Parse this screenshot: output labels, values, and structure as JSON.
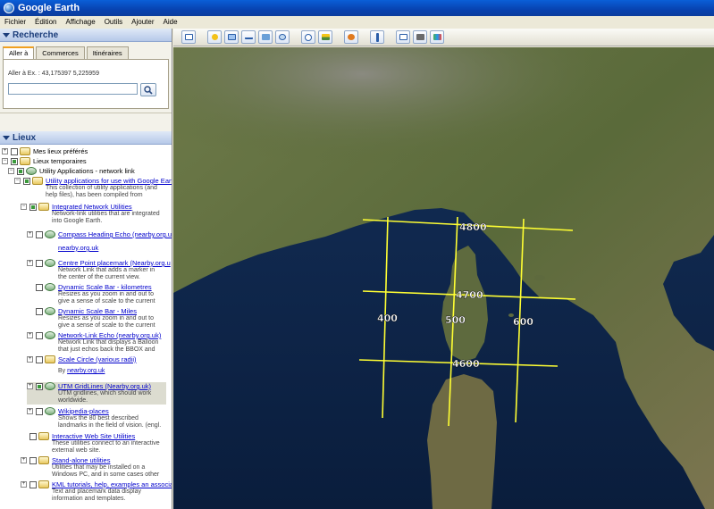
{
  "window": {
    "title": "Google Earth"
  },
  "menu": [
    "Fichier",
    "Édition",
    "Affichage",
    "Outils",
    "Ajouter",
    "Aide"
  ],
  "search": {
    "header": "Recherche",
    "tabs": [
      "Aller à",
      "Commerces",
      "Itinéraires"
    ],
    "hint": "Aller à Ex. : 43,175397 5,225959",
    "input_value": ""
  },
  "places": {
    "header": "Lieux",
    "nodes": {
      "my_places": "Mes lieux préférés",
      "temp_places": "Lieux temporaires",
      "utility_apps": "Utility Applications - network link",
      "utility_for_ge": "Utility applications for use with Google Eart",
      "utility_for_ge_desc": [
        "This collection of utility applications (and",
        "help files), has been compiled from"
      ],
      "integrated": "Integrated Network Utilities",
      "integrated_desc": [
        "Network-link utilities that are integrated",
        "into Google Earth."
      ],
      "compass": "Compass Heading Echo (nearby.org.u",
      "compass_link": "nearby.org.uk",
      "centre_point": "Centre Point placemark (Nearby.org.u",
      "centre_point_desc": [
        "Network Link that adds a marker in",
        "the center of the current view."
      ],
      "scale_km": "Dynamic Scale Bar - kilometres",
      "scale_km_desc": [
        "Resizes as you zoom in and out to",
        "give a sense of scale to the current"
      ],
      "scale_mi": "Dynamic Scale Bar - Miles",
      "scale_mi_desc": [
        "Resizes as you zoom in and out to",
        "give a sense of scale to the current"
      ],
      "netlink_echo": "Network-Link Echo (nearby.org.uk)",
      "netlink_echo_desc": [
        "Network Link that displays a Balloon",
        "that just echos back the BBOX and"
      ],
      "scale_circle": "Scale Circle (various radii)",
      "scale_circle_by": "By ",
      "scale_circle_link": "nearby.org.uk",
      "utm": "UTM GridLines (Nearby.org.uk)",
      "utm_desc": [
        "UTM gridlines, which should work",
        "worldwide."
      ],
      "wikipedia": "Wikipedia-places",
      "wikipedia_desc": [
        "Shows the 80 best described",
        "landmarks in the field of vision. (engl."
      ],
      "interactive": "Interactive Web Site Utilities",
      "interactive_desc": [
        "These utilities connect to an interactive",
        "external web site."
      ],
      "standalone": "Stand-alone utilities",
      "standalone_desc": [
        "Utilities that may be installed on a",
        "Windows PC, and in some cases other"
      ],
      "kml": "KML tutorials, help, examples an associa",
      "kml_desc": [
        "Text and placemark data display",
        "information and templates."
      ]
    }
  },
  "map": {
    "grid_labels": [
      "4800",
      "4700",
      "4600",
      "400",
      "500",
      "600"
    ]
  },
  "colors": {
    "grid": "#ffff33",
    "title_bar": "#0a4fc4",
    "link": "#0000cc"
  }
}
